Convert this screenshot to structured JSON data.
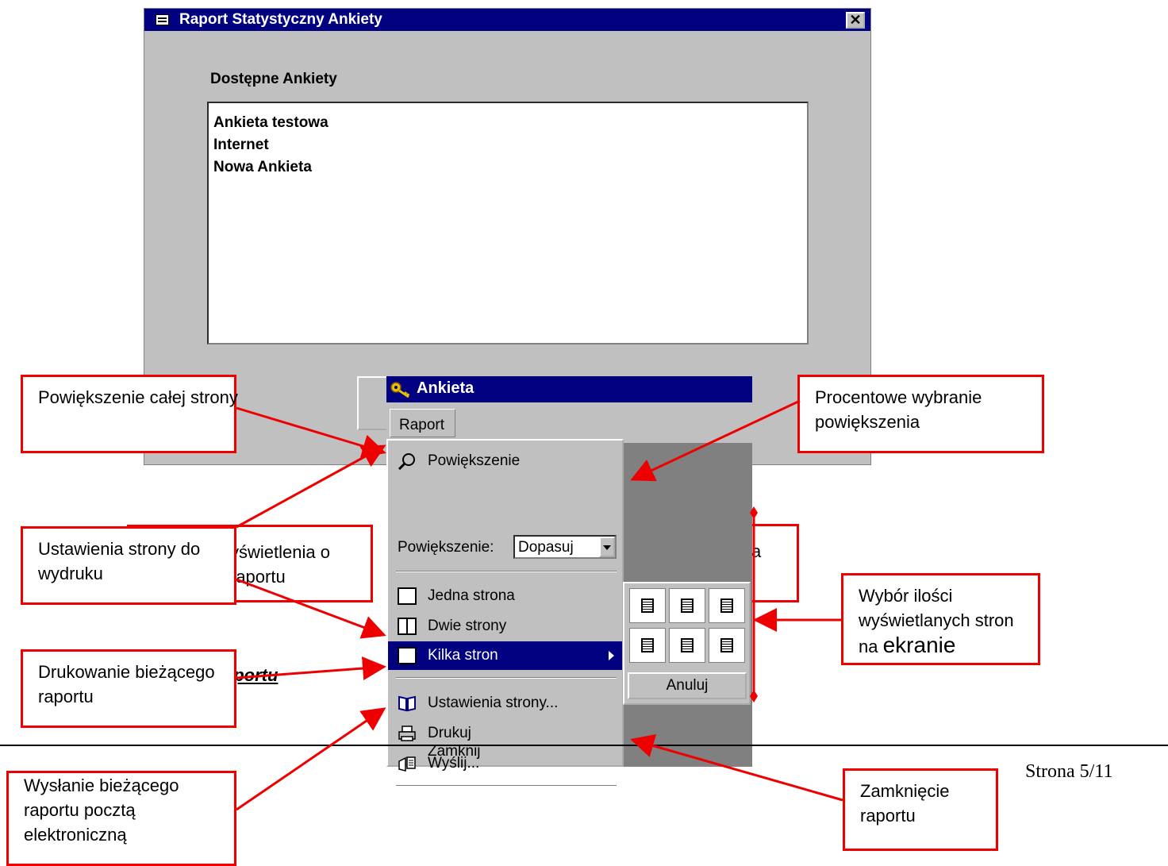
{
  "dialog": {
    "title": "Raport Statystyczny Ankiety",
    "close_label": "✕",
    "list_label": "Dostępne Ankiety",
    "list_items": [
      "Ankieta testowa",
      "Internet",
      "Nowa Ankieta"
    ]
  },
  "menu_window": {
    "title": "Ankieta",
    "menubar": "Raport",
    "items": {
      "zoom": "Powiększenie",
      "zoom_label": "Powiększenie:",
      "zoom_value": "Dopasuj",
      "one_page": "Jedna strona",
      "two_pages": "Dwie strony",
      "multi_pages": "Kilka stron",
      "page_setup": "Ustawienia strony...",
      "print": "Drukuj",
      "send": "Wyślij...",
      "close": "Zamknij"
    },
    "picker_cancel": "Anuluj"
  },
  "callouts": {
    "zoom_page": "Powiększenie całej strony",
    "zoom_percent": "Procentowe wybranie powiększenia",
    "page_setup": "Ustawienia strony do wydruku",
    "hidden_left": "yświetlenia o raportu",
    "hidden_right": "a",
    "pages_choice_1": "Wybór ilości wyświetlanych stron na ",
    "pages_choice_2": "ekranie",
    "print": "Drukowanie bieżącego raportu",
    "send": "Wysłanie bieżącego raportu pocztą elektroniczną",
    "close": "Zamknięcie raportu"
  },
  "underlined_fragment": "aportu",
  "footer": {
    "page_number": "Strona 5/11"
  },
  "colors": {
    "titlebar": "#000080",
    "callout_border": "#e00000",
    "window_face": "#c0c0c0"
  },
  "icons": [
    "form-icon",
    "key-icon",
    "magnifier-icon",
    "one-page-icon",
    "two-pages-icon",
    "multi-pages-icon",
    "book-icon",
    "printer-icon",
    "send-icon"
  ]
}
